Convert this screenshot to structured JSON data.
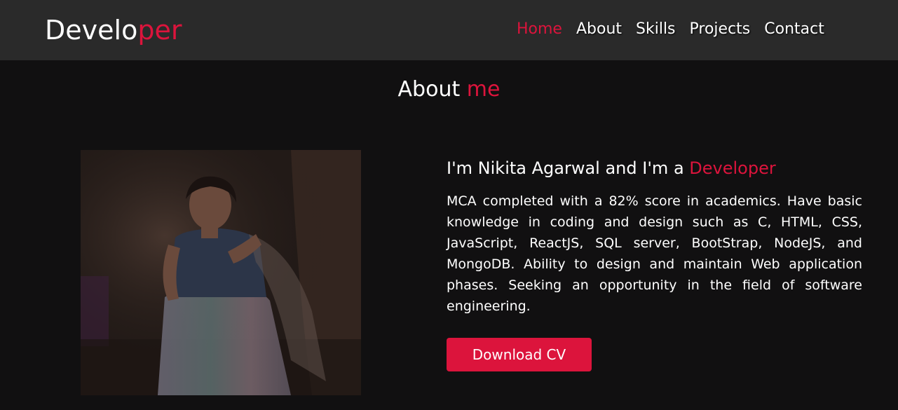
{
  "logo": {
    "prefix": "Develo",
    "accent": "per"
  },
  "nav": {
    "items": [
      {
        "label": "Home",
        "active": true
      },
      {
        "label": "About"
      },
      {
        "label": "Skills"
      },
      {
        "label": "Projects"
      },
      {
        "label": "Contact"
      }
    ]
  },
  "about": {
    "title_prefix": "About ",
    "title_accent": "me",
    "headline_prefix": "I'm Nikita Agarwal and I'm a ",
    "headline_accent": "Developer",
    "bio": "MCA completed with a 82% score in academics. Have basic knowledge in coding and design such as C, HTML, CSS, JavaScript, ReactJS, SQL server, BootStrap, NodeJS, and MongoDB. Ability to design and maintain Web application phases. Seeking an opportunity in the field of software engineering.",
    "button_label": "Download CV"
  },
  "colors": {
    "accent": "#dc143c",
    "navbar_bg": "#2a2a2a",
    "page_bg": "#111011"
  }
}
